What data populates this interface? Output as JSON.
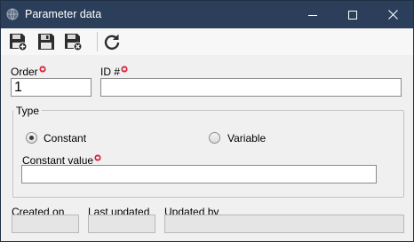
{
  "window": {
    "title": "Parameter data",
    "icon": "globe-icon"
  },
  "toolbar": {
    "buttons": [
      {
        "name": "save-new-button",
        "icon": "save-new-icon"
      },
      {
        "name": "save-button",
        "icon": "save-icon"
      },
      {
        "name": "save-close-button",
        "icon": "save-close-icon"
      },
      {
        "name": "refresh-button",
        "icon": "refresh-icon"
      }
    ]
  },
  "form": {
    "order": {
      "label": "Order",
      "value": "1",
      "required": true
    },
    "id": {
      "label": "ID #",
      "value": "",
      "required": true
    },
    "type": {
      "title": "Type",
      "options": [
        {
          "label": "Constant",
          "selected": true
        },
        {
          "label": "Variable",
          "selected": false
        }
      ]
    },
    "constant_value": {
      "label": "Constant value",
      "value": "",
      "required": true
    },
    "created_on": {
      "label": "Created on",
      "value": ""
    },
    "last_updated": {
      "label": "Last updated",
      "value": ""
    },
    "updated_by": {
      "label": "Updated by",
      "value": ""
    }
  },
  "colors": {
    "titlebar": "#2b3f5a",
    "required_marker": "#d0021b",
    "window_bg": "#f0f0f0"
  }
}
